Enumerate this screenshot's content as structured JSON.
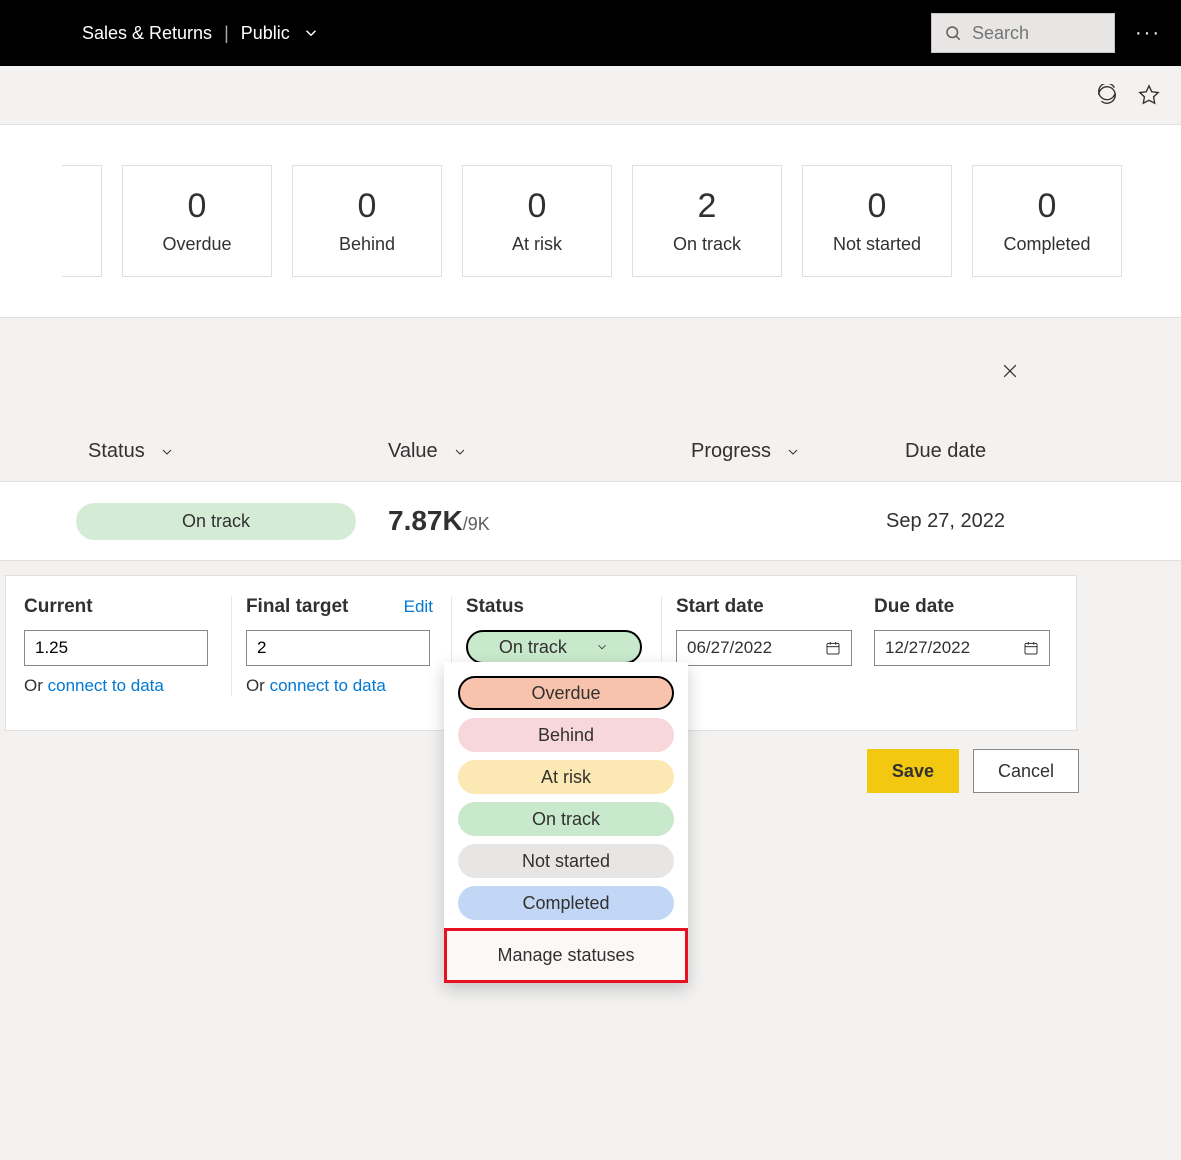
{
  "header": {
    "title": "Sales & Returns",
    "section": "Public",
    "search_placeholder": "Search"
  },
  "status_cards": [
    {
      "count": "0",
      "label": "Overdue"
    },
    {
      "count": "0",
      "label": "Behind"
    },
    {
      "count": "0",
      "label": "At risk"
    },
    {
      "count": "2",
      "label": "On track"
    },
    {
      "count": "0",
      "label": "Not started"
    },
    {
      "count": "0",
      "label": "Completed"
    }
  ],
  "columns": {
    "status": "Status",
    "value": "Value",
    "progress": "Progress",
    "due": "Due date"
  },
  "row": {
    "status": "On track",
    "value": "7.87K",
    "value_target": "/9K",
    "due": "Sep 27, 2022"
  },
  "form": {
    "current_label": "Current",
    "current_value": "1.25",
    "target_label": "Final target",
    "target_value": "2",
    "target_edit": "Edit",
    "status_label": "Status",
    "status_value": "On track",
    "start_label": "Start date",
    "start_value": "06/27/2022",
    "due_label": "Due date",
    "due_value": "12/27/2022",
    "or_prefix": "Or ",
    "connect_link": "connect to data"
  },
  "dropdown": {
    "options": [
      {
        "label": "Overdue",
        "color": "c-overdue",
        "selected": true
      },
      {
        "label": "Behind",
        "color": "c-behind"
      },
      {
        "label": "At risk",
        "color": "c-atrisk"
      },
      {
        "label": "On track",
        "color": "c-ontrack"
      },
      {
        "label": "Not started",
        "color": "c-notstarted"
      },
      {
        "label": "Completed",
        "color": "c-completed"
      }
    ],
    "manage": "Manage statuses"
  },
  "buttons": {
    "save": "Save",
    "cancel": "Cancel"
  }
}
